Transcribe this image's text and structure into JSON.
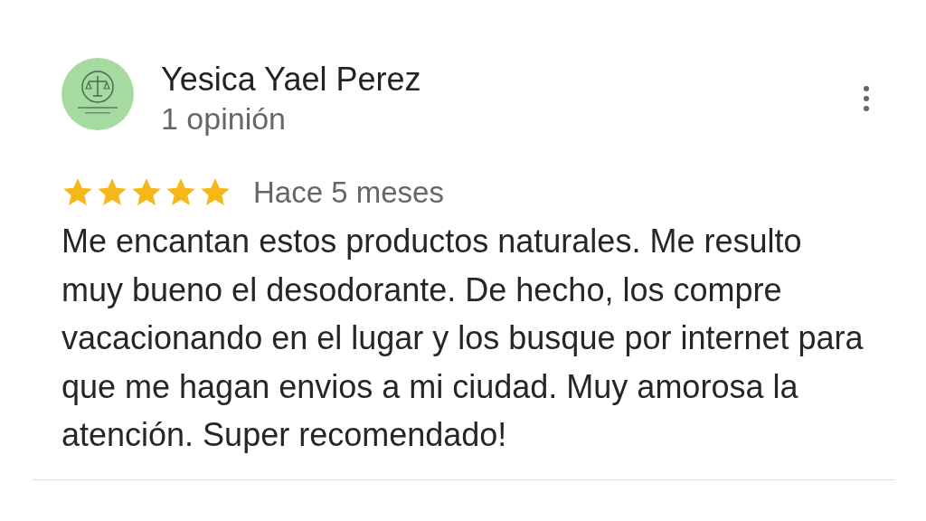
{
  "review": {
    "author": "Yesica Yael Perez",
    "author_meta": "1 opinión",
    "stars": 5,
    "time": "Hace 5 meses",
    "text": "Me encantan estos productos naturales. Me resulto muy bueno el desodorante. De hecho, los compre vacacionando en el lugar y los busque por internet para que me hagan envios a mi ciudad. Muy amorosa la atención. Super recomendado!"
  }
}
